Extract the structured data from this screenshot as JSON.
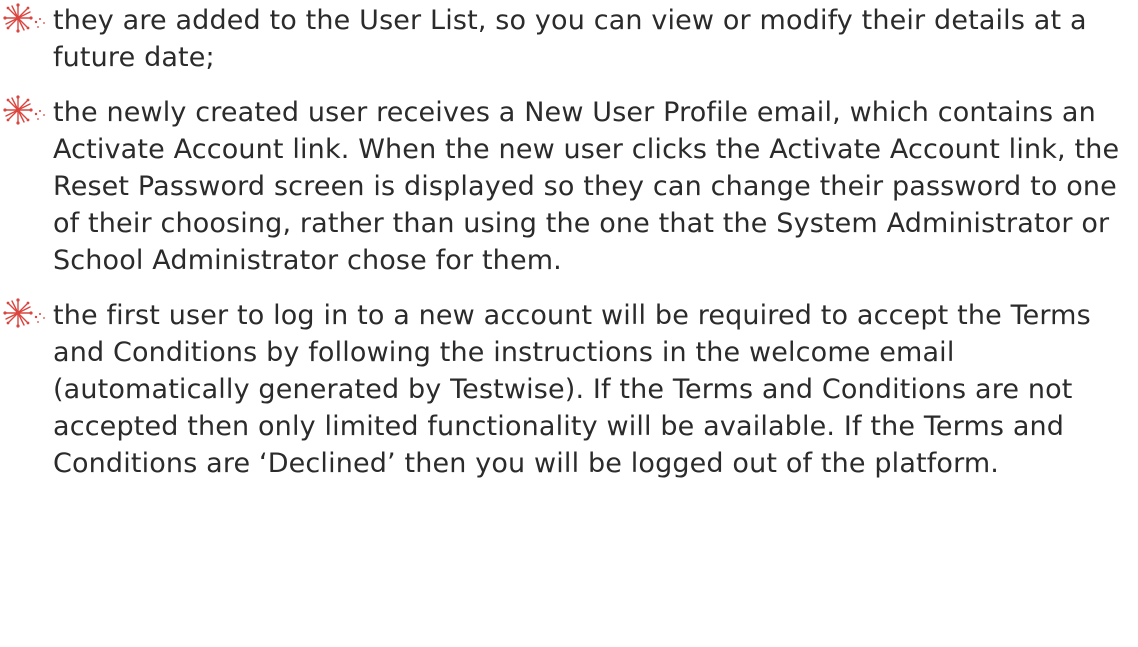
{
  "bullets": [
    {
      "icon": "sparkle-star-icon",
      "text": "they are added to the User List, so you can view or modify their details at a future date;"
    },
    {
      "icon": "sparkle-star-icon",
      "text": "the newly created user receives a New User Profile email, which contains an Activate Account link. When the new user clicks the Activate Account link, the Reset Password screen is displayed so they can change their password to one of their choosing, rather than using the one that the System Administrator or School Administrator chose for them."
    },
    {
      "icon": "sparkle-star-icon",
      "text": "the first user to log in to a new account will be required to accept the Terms and Conditions by following the instructions in the welcome email (automatically generated by Testwise). If the Terms and Conditions are not accepted then only limited functionality will be available. If the Terms and Conditions are ‘Declined’ then you will be logged out of the platform."
    }
  ],
  "colors": {
    "bullet": "#d9463f",
    "text": "#2b2b2b",
    "background": "#ffffff"
  }
}
